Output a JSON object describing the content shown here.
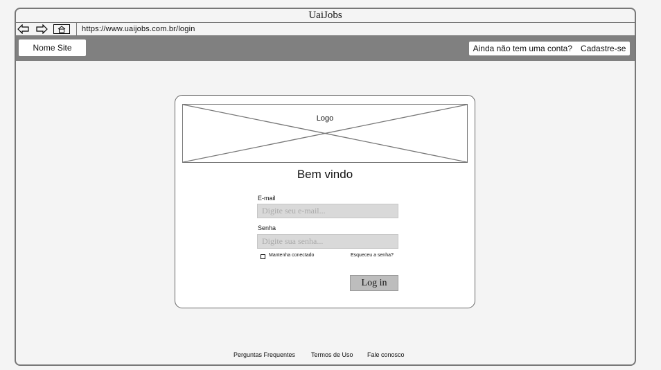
{
  "browser": {
    "title": "UaiJobs",
    "url": "https://www.uaijobs.com.br/login"
  },
  "topnav": {
    "site_name": "Nome Site",
    "signup_prompt": "Ainda não tem uma conta?",
    "signup_link": "Cadastre-se"
  },
  "login_card": {
    "logo_label": "Logo",
    "welcome": "Bem vindo",
    "email_label": "E-mail",
    "email_placeholder": "Digite seu e-mail...",
    "password_label": "Senha",
    "password_placeholder": "Digite sua senha...",
    "remember_label": "Mantenha conectado",
    "forgot_link": "Esqueceu a senha?",
    "login_button": "Log in"
  },
  "footer": {
    "links": [
      "Perguntas Frequentes",
      "Termos de Uso",
      "Fale conosco"
    ]
  }
}
